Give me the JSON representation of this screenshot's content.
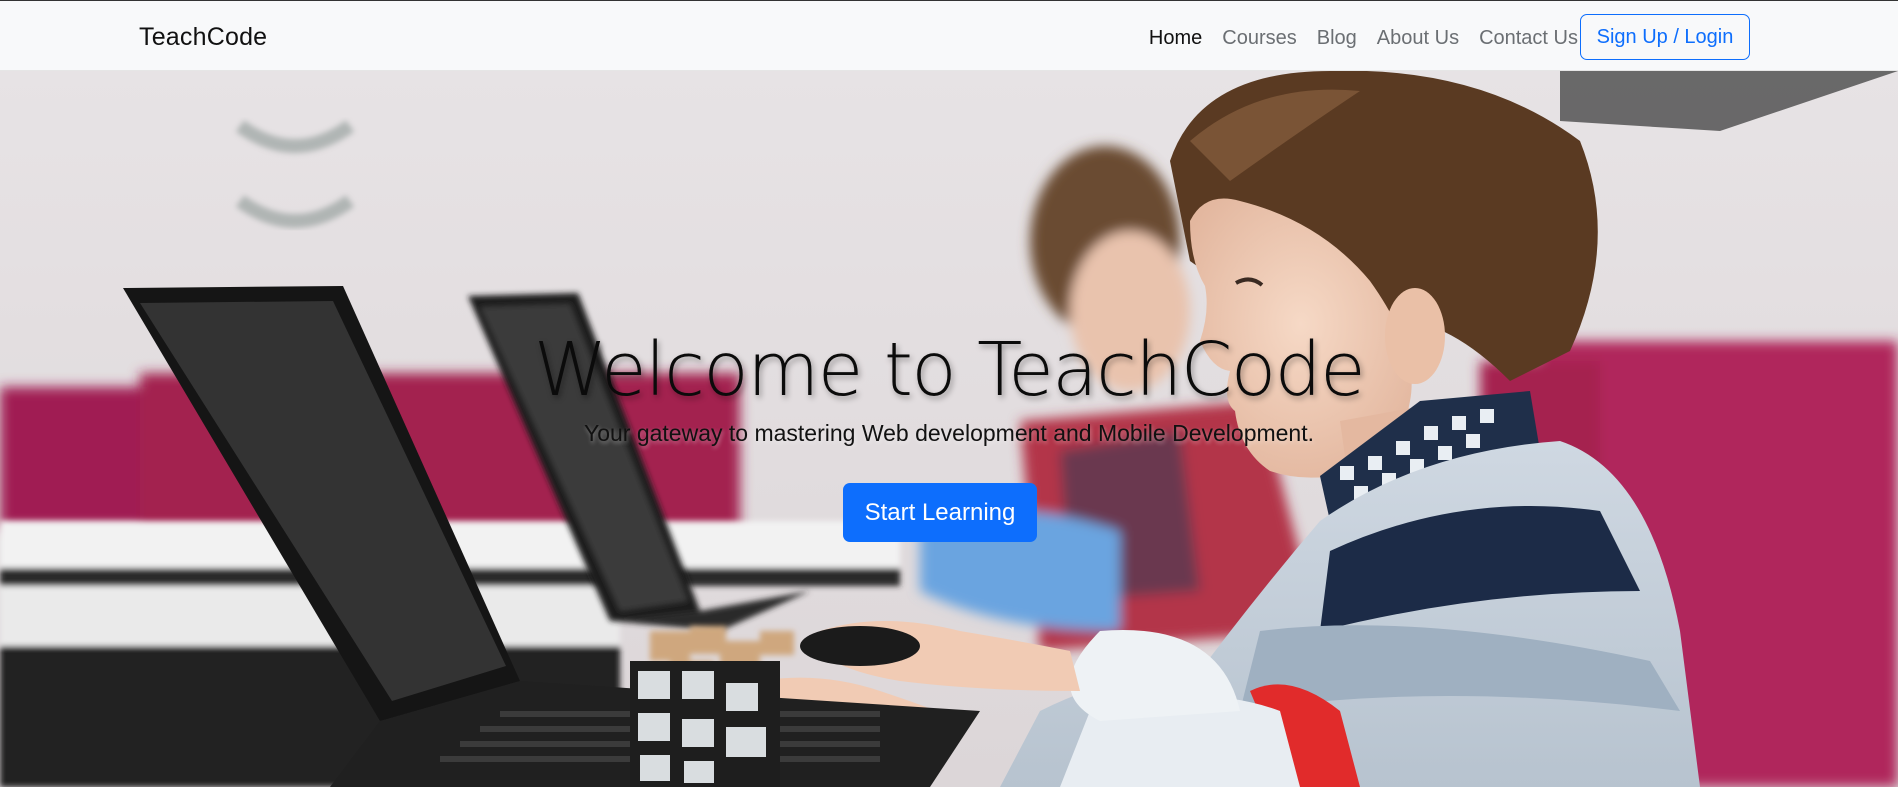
{
  "navbar": {
    "brand": "TeachCode",
    "links": [
      {
        "label": "Home",
        "active": true
      },
      {
        "label": "Courses",
        "active": false
      },
      {
        "label": "Blog",
        "active": false
      },
      {
        "label": "About Us",
        "active": false
      },
      {
        "label": "Contact Us",
        "active": false
      }
    ],
    "auth_button": "Sign Up / Login"
  },
  "hero": {
    "title": "Welcome to TeachCode",
    "subtitle": "Your gateway to mastering Web development and Mobile Development.",
    "cta_label": "Start Learning",
    "background_image": "photo of children using laptops in a classroom"
  },
  "colors": {
    "primary": "#0d6efd",
    "navbar_bg": "#f8f9fa"
  }
}
